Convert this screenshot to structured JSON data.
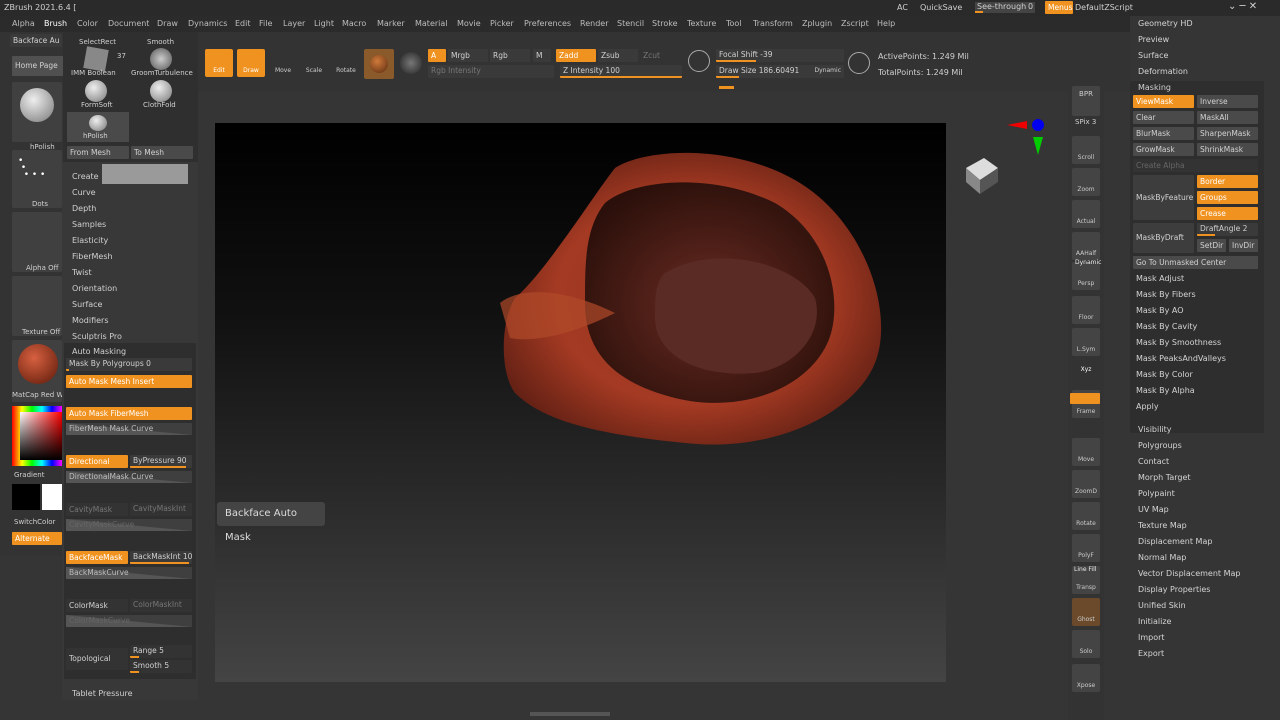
{
  "title": "ZBrush 2021.6.4 [",
  "titlebar": {
    "ac": "AC",
    "quicksave": "QuickSave",
    "seethrough": "See-through",
    "seethrough_val": "0",
    "menus": "Menus",
    "script": "DefaultZScript"
  },
  "menu": [
    "Alpha",
    "Brush",
    "Color",
    "Document",
    "Draw",
    "Dynamics",
    "Edit",
    "File",
    "Layer",
    "Light",
    "Macro",
    "Marker",
    "Material",
    "Movie",
    "Picker",
    "Preferences",
    "Render",
    "Stencil",
    "Stroke",
    "Texture",
    "Tool",
    "Transform",
    "Zplugin",
    "Zscript",
    "Help"
  ],
  "toolbar": {
    "backface": "Backface Au",
    "homepage": "Home Page",
    "edit": "Edit",
    "draw": "Draw",
    "move": "Move",
    "scale": "Scale",
    "rotate": "Rotate",
    "a": "A",
    "mrgb": "Mrgb",
    "rgb": "Rgb",
    "m": "M",
    "rgb_intensity": "Rgb Intensity",
    "zadd": "Zadd",
    "zsub": "Zsub",
    "zcut": "Zcut",
    "z_intensity": "Z Intensity 100",
    "focal_shift": "Focal Shift -39",
    "draw_size": "Draw Size 186.60491",
    "dynamic": "Dynamic",
    "active_points": "ActivePoints: 1.249 Mil",
    "total_points": "TotalPoints: 1.249 Mil"
  },
  "brushes": {
    "count": "37",
    "items": [
      "SelectRect",
      "Smooth",
      "IMM Boolean",
      "GroomTurbulence",
      "FormSoft",
      "ClothFold",
      "hPolish"
    ],
    "from_mesh": "From Mesh",
    "to_mesh": "To Mesh"
  },
  "brush_menu": [
    "Create",
    "Curve",
    "Depth",
    "Samples",
    "Elasticity",
    "FiberMesh",
    "Twist",
    "Orientation",
    "Surface",
    "Modifiers",
    "Sculptris Pro"
  ],
  "left": {
    "hpolish": "hPolish",
    "dots": "Dots",
    "alpha_off": "Alpha Off",
    "texture_off": "Texture Off",
    "matcap": "MatCap Red W",
    "gradient": "Gradient",
    "switchcolor": "SwitchColor",
    "alternate": "Alternate"
  },
  "automask": {
    "title": "Auto Masking",
    "by_polygroups": "Mask By Polygroups 0",
    "mesh_insert": "Auto Mask Mesh Insert",
    "fibermesh": "Auto Mask FiberMesh",
    "fibermesh_curve": "FiberMesh Mask Curve",
    "directional": "Directional",
    "bypressure": "ByPressure 90",
    "directional_curve": "DirectionalMask Curve",
    "cavitymask": "CavityMask",
    "cavitymaskint": "CavityMaskInt",
    "cavitymaskcurve": "CavityMaskCurve",
    "backfacemask": "BackfaceMask",
    "backmaskint": "BackMaskInt 10",
    "backmaskcurve": "BackMaskCurve",
    "colormask": "ColorMask",
    "colormaskint": "ColorMaskInt",
    "colormaskcurve": "ColorMaskCurve",
    "topological": "Topological",
    "range": "Range 5",
    "smooth": "Smooth 5",
    "tablet": "Tablet Pressure",
    "bypressure_level": 0.9
  },
  "tooltip": "Backface Auto Mask",
  "rightbar": [
    "SPix 3",
    "Scroll",
    "Zoom",
    "Actual",
    "AAHalf",
    "Persp",
    "Floor",
    "L.Sym",
    "Xyz",
    "Frame",
    "Move",
    "ZoomD",
    "Rotate",
    "PolyF",
    "Transp",
    "Ghost",
    "Solo",
    "Xpose"
  ],
  "rightbar_extra": {
    "bpr": "BPR",
    "dynamic": "Dynamic",
    "linefill": "Line Fill"
  },
  "tool_top": [
    "Geometry HD",
    "Preview",
    "Surface",
    "Deformation"
  ],
  "masking": {
    "title": "Masking",
    "viewmask": "ViewMask",
    "inverse": "Inverse",
    "clear": "Clear",
    "maskall": "MaskAll",
    "blurmask": "BlurMask",
    "sharpenmask": "SharpenMask",
    "growmask": "GrowMask",
    "shrinkmask": "ShrinkMask",
    "create_alpha": "Create Alpha",
    "maskbyfeature": "MaskByFeature",
    "border": "Border",
    "groups": "Groups",
    "crease": "Crease",
    "maskbydraft": "MaskByDraft",
    "draftangle": "DraftAngle 2",
    "setdir": "SetDir",
    "invdir": "InvDir",
    "goto": "Go To Unmasked Center",
    "list": [
      "Mask Adjust",
      "Mask By Fibers",
      "Mask By AO",
      "Mask By Cavity",
      "Mask By Smoothness",
      "Mask PeaksAndValleys",
      "Mask By Color",
      "Mask By Alpha",
      "Apply"
    ]
  },
  "tool_bottom": [
    "Visibility",
    "Polygroups",
    "Contact",
    "Morph Target",
    "Polypaint",
    "UV Map",
    "Texture Map",
    "Displacement Map",
    "Normal Map",
    "Vector Displacement Map",
    "Display Properties",
    "Unified Skin",
    "Initialize",
    "Import",
    "Export"
  ],
  "colors": {
    "accent": "#f0921f",
    "model": "#a83a22"
  }
}
